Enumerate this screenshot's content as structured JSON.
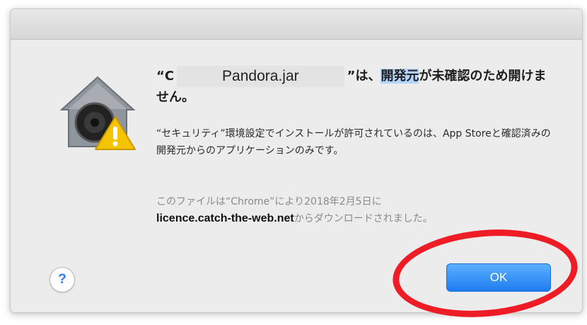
{
  "dialog": {
    "heading_open": "“C",
    "heading_redacted": "Pandora.jar",
    "heading_close": "”は、",
    "heading_highlight": "開発元",
    "heading_rest": "が未確認のため開けません。",
    "body": "“セキュリティ”環境設定でインストールが許可されているのは、App Storeと確認済みの開発元からのアプリケーションのみです。",
    "source_prefix": "このファイルは“Chrome”により2018年2月5日に",
    "source_domain": "licence.catch-the-web.net",
    "source_suffix": "からダウンロードされました。",
    "help_label": "?",
    "ok_label": "OK"
  },
  "icons": {
    "app_icon": "gatekeeper-house-icon",
    "warning_icon": "warning-triangle-icon"
  },
  "colors": {
    "ok_button": "#1f7cf0",
    "highlight": "#b3d4fc",
    "annotation_circle": "#ee1c24"
  }
}
